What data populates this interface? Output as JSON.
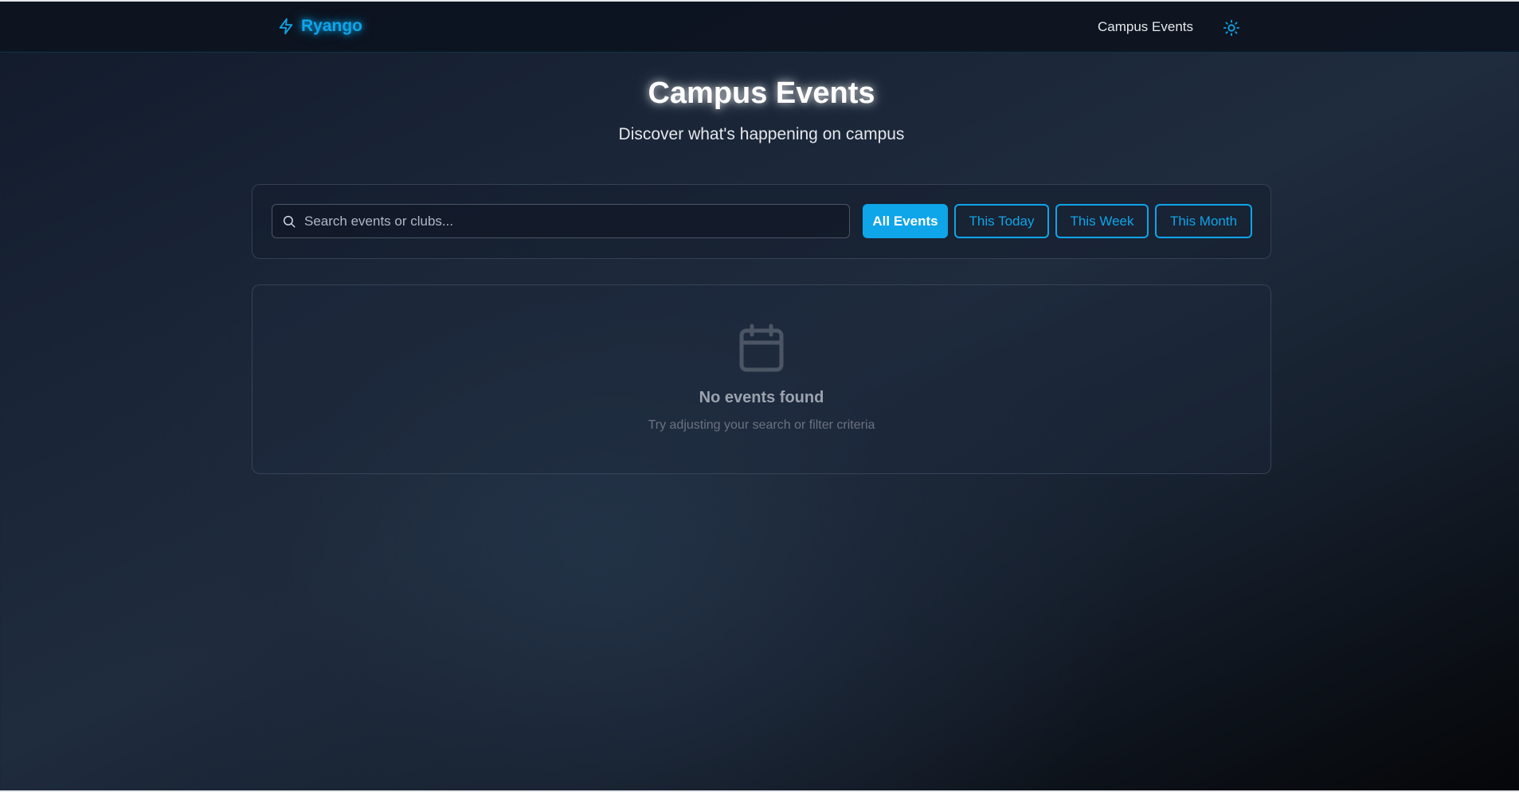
{
  "nav": {
    "brand": "Ryango",
    "links": [
      "Campus Events"
    ],
    "brand_icon": "lightning-bolt-icon",
    "theme_icon": "sun-icon"
  },
  "hero": {
    "title": "Campus Events",
    "subtitle": "Discover what's happening on campus"
  },
  "filters": {
    "search_placeholder": "Search events or clubs...",
    "search_value": "",
    "buttons": [
      {
        "label": "All Events",
        "active": true
      },
      {
        "label": "This Today",
        "active": false
      },
      {
        "label": "This Week",
        "active": false
      },
      {
        "label": "This Month",
        "active": false
      }
    ]
  },
  "empty_state": {
    "icon": "calendar-icon",
    "title": "No events found",
    "description": "Try adjusting your search or filter criteria"
  },
  "colors": {
    "accent": "#0ea5e9",
    "background": "#1a2638",
    "muted_text": "#9ca3af"
  }
}
